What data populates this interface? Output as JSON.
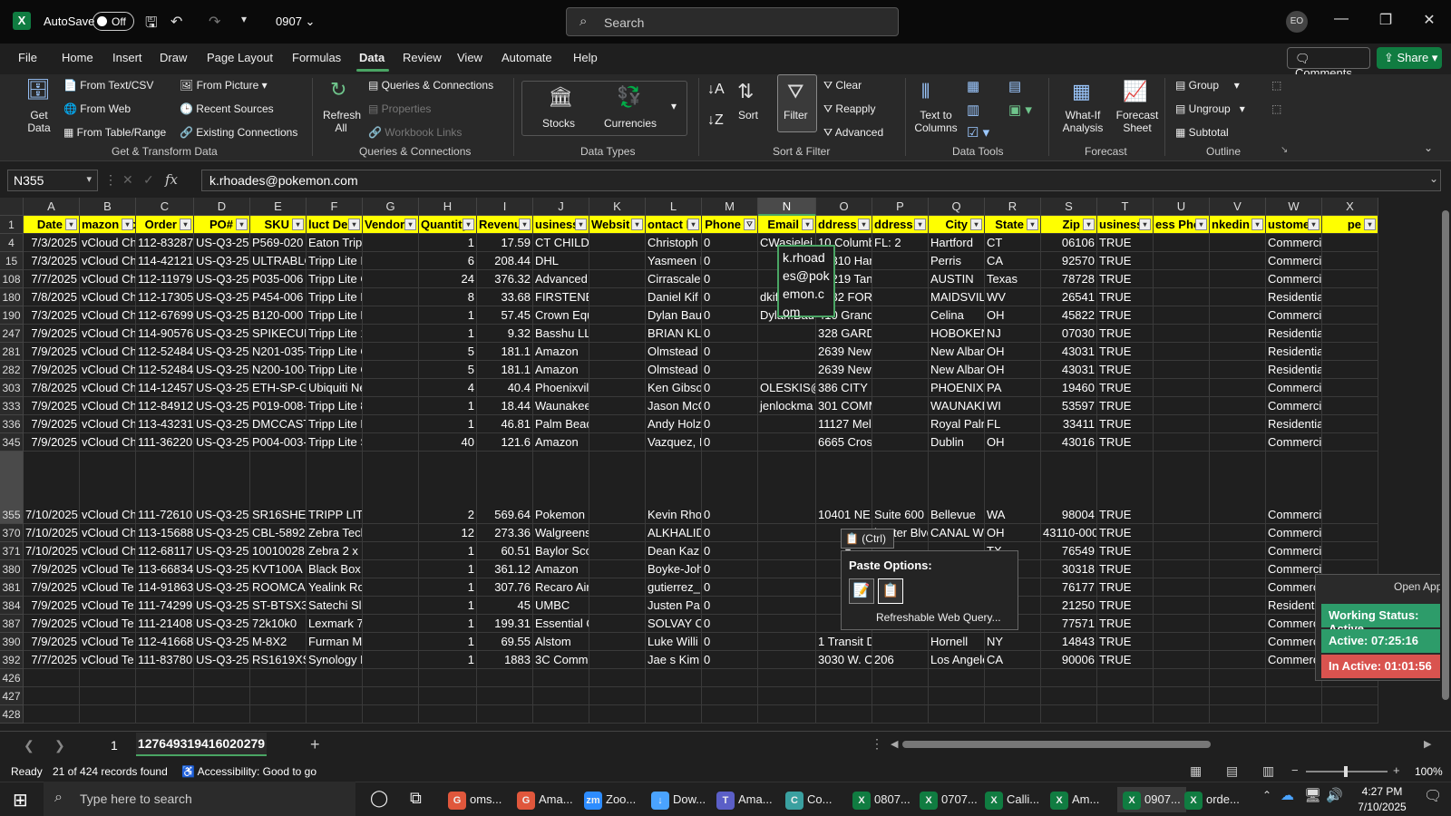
{
  "title_bar": {
    "autosave_label": "AutoSave",
    "autosave_state": "Off",
    "document_name": "0907",
    "search_placeholder": "Search",
    "avatar_initials": "EO"
  },
  "menu": {
    "items": [
      "File",
      "Home",
      "Insert",
      "Draw",
      "Page Layout",
      "Formulas",
      "Data",
      "Review",
      "View",
      "Automate",
      "Help"
    ],
    "active": "Data",
    "comments_label": "Comments",
    "share_label": "Share"
  },
  "ribbon": {
    "get_data": "Get Data",
    "from_text_csv": "From Text/CSV",
    "from_web": "From Web",
    "from_table_range": "From Table/Range",
    "from_picture": "From Picture",
    "recent_sources": "Recent Sources",
    "existing_connections": "Existing Connections",
    "group_get_transform": "Get & Transform Data",
    "refresh_all": "Refresh All",
    "queries_connections": "Queries & Connections",
    "properties": "Properties",
    "workbook_links": "Workbook Links",
    "group_queries": "Queries & Connections",
    "stocks": "Stocks",
    "currencies": "Currencies",
    "group_data_types": "Data Types",
    "sort": "Sort",
    "filter": "Filter",
    "clear": "Clear",
    "reapply": "Reapply",
    "advanced": "Advanced",
    "group_sort_filter": "Sort & Filter",
    "text_to_columns": "Text to Columns",
    "group_data_tools": "Data Tools",
    "what_if": "What-If Analysis",
    "forecast_sheet": "Forecast Sheet",
    "group_forecast": "Forecast",
    "group": "Group",
    "ungroup": "Ungroup",
    "subtotal": "Subtotal",
    "group_outline": "Outline"
  },
  "formula_bar": {
    "name_box": "N355",
    "value": "k.rhoades@pokemon.com"
  },
  "columns": [
    "A",
    "B",
    "C",
    "D",
    "E",
    "F",
    "G",
    "H",
    "I",
    "J",
    "K",
    "L",
    "M",
    "N",
    "O",
    "P",
    "Q",
    "R",
    "S",
    "T",
    "U",
    "V",
    "W",
    "X"
  ],
  "header_row": {
    "row_number": "1",
    "cells": [
      "Date",
      "mazon Ac",
      "Order",
      "PO#",
      "SKU",
      "luct Des",
      "Vendor",
      "Quantity",
      "Revenu",
      "usiness I",
      "Websit",
      "ontact N",
      "Phone",
      "Email",
      "ddress L",
      "ddress L",
      "City",
      "State",
      "Zip",
      "usiness",
      "ess Phor",
      "nkedin P",
      "ustomer",
      "pe"
    ]
  },
  "rows": [
    {
      "n": "4",
      "c": [
        "7/3/2025",
        "vCloud Ch",
        "112-83287",
        "US-Q3-25-",
        "P569-020",
        "Eaton Tripp Lite High",
        "",
        "1",
        "17.59",
        "CT CHILDREN'S MEDI",
        "",
        "Christoph",
        "0",
        "CWasielei",
        "10 Columb",
        "FL: 2",
        "Hartford",
        "CT",
        "06106",
        "TRUE",
        "",
        "",
        "Commercial",
        ""
      ]
    },
    {
      "n": "15",
      "c": [
        "7/3/2025",
        "vCloud Ch",
        "114-42121",
        "US-Q3-25-",
        "ULTRABLO",
        "Tripp Lite Isobar Surg",
        "",
        "6",
        "208.44",
        "DHL",
        "",
        "Yasmeen I",
        "0",
        "",
        "18310 Harvill Ave Ste",
        "",
        "Perris",
        "CA",
        "92570",
        "TRUE",
        "",
        "",
        "Commercial",
        ""
      ]
    },
    {
      "n": "108",
      "c": [
        "7/7/2025",
        "vCloud Ch",
        "112-11979",
        "US-Q3-25-",
        "P035-006",
        "Tripp Lite C20 to C21",
        "",
        "24",
        "376.32",
        "Advanced Micro Devi",
        "",
        "Cirrascale",
        "0",
        "",
        "14219 Tan CPE - Nare",
        "",
        "AUSTIN",
        "Texas",
        "78728",
        "TRUE",
        "",
        "",
        "Commercial",
        ""
      ]
    },
    {
      "n": "180",
      "c": [
        "7/8/2025",
        "vCloud Ch",
        "112-17305",
        "US-Q3-25-",
        "P454-006",
        "Tripp Lite Null Moder",
        "",
        "8",
        "33.68",
        "FIRSTENERGY SERVIC",
        "",
        "Daniel Kif",
        "0",
        "dkifer1@fi",
        "1732 FORT MARTIN R",
        "",
        "MAIDSVILL",
        "WV",
        "26541",
        "TRUE",
        "",
        "",
        "Residential",
        ""
      ]
    },
    {
      "n": "190",
      "c": [
        "7/3/2025",
        "vCloud Ch",
        "112-67699",
        "US-Q3-25-",
        "B120-000",
        "Tripp Lite DVI Extend",
        "",
        "1",
        "57.45",
        "Crown Equipment",
        "",
        "Dylan Bau",
        "0",
        "Dylan.Bau",
        "410 Grand Lake Road",
        "",
        "Celina",
        "OH",
        "45822",
        "TRUE",
        "",
        "",
        "Commercial",
        ""
      ]
    },
    {
      "n": "247",
      "c": [
        "7/9/2025",
        "vCloud Ch",
        "114-90576",
        "US-Q3-25-",
        "SPIKECUB",
        "Tripp Lite 1 Outlet Po",
        "",
        "1",
        "9.32",
        "Basshu LLC",
        "",
        "BRIAN KLE",
        "0",
        "",
        "328 GARDEN ST APT 1",
        "",
        "HOBOKEN",
        "NJ",
        "07030",
        "TRUE",
        "",
        "",
        "Residential",
        ""
      ]
    },
    {
      "n": "281",
      "c": [
        "7/9/2025",
        "vCloud Ch",
        "112-52484",
        "US-Q3-25-",
        "N201-035-",
        "Tripp Lite Cat6 Gigab",
        "",
        "5",
        "181.1",
        "Amazon",
        "",
        "Olmstead",
        "0",
        "",
        "2639 Newton Court",
        "",
        "New Albar",
        "OH",
        "43031",
        "TRUE",
        "",
        "",
        "Residential",
        ""
      ]
    },
    {
      "n": "282",
      "c": [
        "7/9/2025",
        "vCloud Ch",
        "112-52484",
        "US-Q3-25-",
        "N200-100-",
        "Tripp Lite Cat6 Cat5e",
        "",
        "5",
        "181.1",
        "Amazon",
        "",
        "Olmstead",
        "0",
        "",
        "2639 Newton Court",
        "",
        "New Albar",
        "OH",
        "43031",
        "TRUE",
        "",
        "",
        "Residential",
        ""
      ]
    },
    {
      "n": "303",
      "c": [
        "7/8/2025",
        "vCloud Ch",
        "114-12457",
        "US-Q3-25-",
        "ETH-SP-G2",
        "Ubiquiti Networks ET",
        "",
        "4",
        "40.4",
        "Phoenixville School I",
        "",
        "Ken Gibso",
        "0",
        "OLESKIS@",
        "386 CITY LINE AVE",
        "",
        "PHOENIXV",
        "PA",
        "19460",
        "TRUE",
        "",
        "",
        "Commercial",
        ""
      ]
    },
    {
      "n": "333",
      "c": [
        "7/9/2025",
        "vCloud Ch",
        "112-84912",
        "US-Q3-25-",
        "P019-008-",
        "Tripp Lite 8ft Heavy D",
        "",
        "1",
        "18.44",
        "Waunakee Commun",
        "",
        "Jason McC",
        "0",
        "jenlockma",
        "301 COMMUNITY DRI",
        "",
        "WAUNAKE",
        "WI",
        "53597",
        "TRUE",
        "",
        "",
        "Commercial",
        ""
      ]
    },
    {
      "n": "336",
      "c": [
        "7/9/2025",
        "vCloud Ch",
        "113-43231",
        "US-Q3-25-",
        "DMCCASTI",
        "Tripp Lite Locking Ca",
        "",
        "1",
        "46.81",
        "Palm Beach Bots",
        "",
        "Andy Holz",
        "0",
        "",
        "11127 Mellow Ct",
        "",
        "Royal Paln",
        "FL",
        "33411",
        "TRUE",
        "",
        "",
        "Residential",
        ""
      ]
    },
    {
      "n": "345",
      "c": [
        "7/9/2025",
        "vCloud Ch",
        "111-36220",
        "US-Q3-25-",
        "P004-003-",
        "Tripp Lite Standard C",
        "",
        "40",
        "121.6",
        "Amazon",
        "",
        "Vazquez, I",
        "0",
        "",
        "6665 Crosby Court",
        "",
        "Dublin",
        "OH",
        "43016",
        "TRUE",
        "",
        "",
        "Commercial",
        ""
      ]
    },
    {
      "n": "355",
      "c": [
        "7/10/2025",
        "vCloud Ch",
        "111-72610",
        "US-Q3-25-",
        "SR16SHELI",
        "TRIPP LITE 3U Rack M",
        "",
        "2",
        "569.64",
        "Pokemon Co Intl",
        "",
        "Kevin Rho",
        "0",
        "",
        "10401 NE 8",
        "Suite 600",
        "Bellevue",
        "WA",
        "98004",
        "TRUE",
        "",
        "",
        "Commercial",
        ""
      ]
    },
    {
      "n": "370",
      "c": [
        "7/10/2025",
        "vCloud Ch",
        "113-15688",
        "US-Q3-25-",
        "CBL-58926",
        "Zebra Technologies C",
        "",
        "12",
        "273.36",
        "Walgreens",
        "",
        "ALKHALIDI",
        "0",
        "",
        "",
        "hester Blvd",
        "CANAL WI",
        "OH",
        "43110-000",
        "TRUE",
        "",
        "",
        "Commercial",
        ""
      ]
    },
    {
      "n": "371",
      "c": [
        "7/10/2025",
        "vCloud Ch",
        "112-68117",
        "US-Q3-25-",
        "10010028",
        "Zebra 2 x 1 in Direct T",
        "",
        "1",
        "60.51",
        "Baylor Scott & White",
        "",
        "Dean Kaz",
        "0",
        "",
        "",
        "",
        "",
        "TX",
        "76549",
        "TRUE",
        "",
        "",
        "Commercial",
        ""
      ]
    },
    {
      "n": "380",
      "c": [
        "7/9/2025",
        "vCloud Te",
        "113-66834",
        "US-Q3-25-",
        "KVT100A",
        "Black Box Network Se",
        "",
        "1",
        "361.12",
        "Amazon",
        "",
        "Boyke-Joh",
        "0",
        "",
        "",
        "",
        "",
        "GA",
        "30318",
        "TRUE",
        "",
        "",
        "Commercial",
        ""
      ]
    },
    {
      "n": "381",
      "c": [
        "7/9/2025",
        "vCloud Te",
        "114-91863",
        "US-Q3-25-",
        "ROOMCAS",
        "Yealink RoomCast sy",
        "",
        "1",
        "307.76",
        "Recaro Aircraft Seati",
        "",
        "gutierrez_",
        "0",
        "",
        "",
        "",
        "",
        "Texas",
        "76177",
        "TRUE",
        "",
        "",
        "Commercial",
        ""
      ]
    },
    {
      "n": "384",
      "c": [
        "7/9/2025",
        "vCloud Te",
        "111-74299",
        "US-Q3-25-",
        "ST-BTSX3N",
        "Satechi Slim X3 Bluet",
        "",
        "1",
        "45",
        "UMBC",
        "",
        "Justen Pa",
        "0",
        "",
        "",
        "",
        "",
        "MD",
        "21250",
        "TRUE",
        "",
        "",
        "Residential",
        ""
      ]
    },
    {
      "n": "387",
      "c": [
        "7/9/2025",
        "vCloud Te",
        "111-21408",
        "US-Q3-25-",
        "72k10k0",
        "Lexmark 72K10K0 CS",
        "",
        "1",
        "199.31",
        "Essential Chemicals",
        "",
        "SOLVAY CH",
        "0",
        "",
        "",
        "",
        "",
        "TX",
        "77571",
        "TRUE",
        "",
        "",
        "Commercial",
        ""
      ]
    },
    {
      "n": "390",
      "c": [
        "7/9/2025",
        "vCloud Te",
        "112-41668",
        "US-Q3-25-",
        "M-8X2",
        "Furman M-8X2 Merit",
        "",
        "1",
        "69.55",
        "Alstom",
        "",
        "Luke Willi",
        "0",
        "",
        "1 Transit Drive",
        "",
        "Hornell",
        "NY",
        "14843",
        "TRUE",
        "",
        "",
        "Commercial",
        ""
      ]
    },
    {
      "n": "392",
      "c": [
        "7/7/2025",
        "vCloud Te",
        "111-83780",
        "US-Q3-25-",
        "RS1619XS",
        "Synology NAS Rackst",
        "",
        "1",
        "1883",
        "3C Community Clinic",
        "",
        "Jae s Kim",
        "0",
        "",
        "3030 W. O",
        "206",
        "Los Angele",
        "CA",
        "90006",
        "TRUE",
        "",
        "",
        "Commercial",
        ""
      ]
    }
  ],
  "empty_rows": [
    "426",
    "427",
    "428"
  ],
  "active_cell_text": "k.rhoades@pokemon.com",
  "paste": {
    "button_label": "(Ctrl)",
    "menu_title": "Paste Options:",
    "refreshable": "Refreshable Web Query..."
  },
  "widget": {
    "open_app": "Open App",
    "working_status": "Working Status: Active",
    "active": "Active: 07:25:16",
    "inactive": "In Active: 01:01:56",
    "colors": {
      "working": "#2d9c6a",
      "active": "#2d9c6a",
      "inactive": "#d9534f"
    }
  },
  "sheet_tabs": {
    "first": "1",
    "active": "127649319416020279",
    "add": "+"
  },
  "status_bar": {
    "ready": "Ready",
    "records": "21 of 424 records found",
    "accessibility": "Accessibility: Good to go",
    "zoom": "100%"
  },
  "taskbar": {
    "search_placeholder": "Type here to search",
    "apps": [
      "oms...",
      "Ama...",
      "Zoo...",
      "Dow...",
      "Ama...",
      "Co...",
      "0807...",
      "0707...",
      "Calli...",
      "Am...",
      "0907...",
      "orde..."
    ],
    "time": "4:27 PM",
    "date": "7/10/2025"
  }
}
